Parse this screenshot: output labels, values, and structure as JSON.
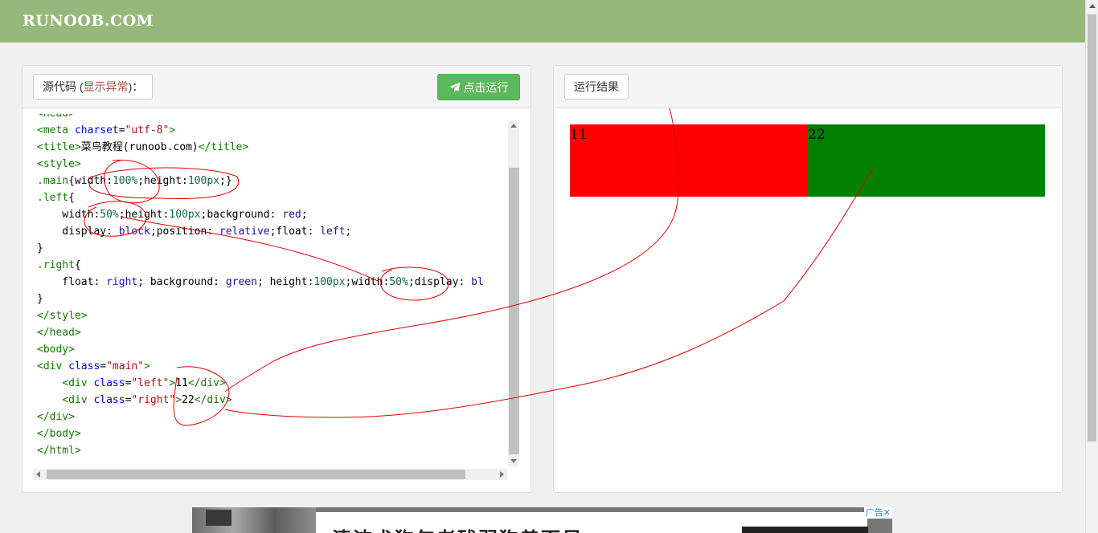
{
  "site": {
    "logo": "RUNOOB.COM"
  },
  "left_panel": {
    "source_label_prefix": "源代码 (",
    "source_label_error": "显示异常",
    "source_label_suffix": ")：",
    "run_button": "点击运行",
    "code_lines": [
      [
        {
          "c": "t",
          "v": "<head>"
        }
      ],
      [
        {
          "c": "t",
          "v": "<meta "
        },
        {
          "c": "a",
          "v": "charset"
        },
        {
          "c": "q",
          "v": "="
        },
        {
          "c": "s",
          "v": "\"utf-8\""
        },
        {
          "c": "t",
          "v": ">"
        }
      ],
      [
        {
          "c": "t",
          "v": "<title>"
        },
        {
          "c": "q",
          "v": "菜鸟教程(runoob.com)"
        },
        {
          "c": "t",
          "v": "</title>"
        }
      ],
      [
        {
          "c": "t",
          "v": "<style>"
        }
      ],
      [
        {
          "c": "t",
          "v": ".main"
        },
        {
          "c": "q",
          "v": "{width:"
        },
        {
          "c": "n",
          "v": "100%"
        },
        {
          "c": "q",
          "v": ";height:"
        },
        {
          "c": "n",
          "v": "100px"
        },
        {
          "c": "q",
          "v": ";}"
        }
      ],
      [
        {
          "c": "t",
          "v": ".left"
        },
        {
          "c": "q",
          "v": "{"
        }
      ],
      [
        {
          "c": "q",
          "v": "    width:"
        },
        {
          "c": "n",
          "v": "50%"
        },
        {
          "c": "q",
          "v": ";height:"
        },
        {
          "c": "n",
          "v": "100px"
        },
        {
          "c": "q",
          "v": ";background: "
        },
        {
          "c": "k",
          "v": "red"
        },
        {
          "c": "q",
          "v": ";"
        }
      ],
      [
        {
          "c": "q",
          "v": "    display: "
        },
        {
          "c": "k",
          "v": "block"
        },
        {
          "c": "q",
          "v": ";position: "
        },
        {
          "c": "k",
          "v": "relative"
        },
        {
          "c": "q",
          "v": ";float: "
        },
        {
          "c": "k",
          "v": "left"
        },
        {
          "c": "q",
          "v": ";"
        }
      ],
      [
        {
          "c": "q",
          "v": "}"
        }
      ],
      [
        {
          "c": "t",
          "v": ".right"
        },
        {
          "c": "q",
          "v": "{"
        }
      ],
      [
        {
          "c": "q",
          "v": "    float: "
        },
        {
          "c": "k",
          "v": "right"
        },
        {
          "c": "q",
          "v": "; background: "
        },
        {
          "c": "k",
          "v": "green"
        },
        {
          "c": "q",
          "v": "; height:"
        },
        {
          "c": "n",
          "v": "100px"
        },
        {
          "c": "q",
          "v": ";width:"
        },
        {
          "c": "n",
          "v": "50%"
        },
        {
          "c": "q",
          "v": ";display: "
        },
        {
          "c": "k",
          "v": "bl"
        }
      ],
      [
        {
          "c": "q",
          "v": "}"
        }
      ],
      [
        {
          "c": "t",
          "v": "</style>"
        }
      ],
      [
        {
          "c": "t",
          "v": "</head>"
        }
      ],
      [
        {
          "c": "t",
          "v": "<body>"
        }
      ],
      [
        {
          "c": "t",
          "v": "<div "
        },
        {
          "c": "a",
          "v": "class"
        },
        {
          "c": "q",
          "v": "="
        },
        {
          "c": "s",
          "v": "\"main\""
        },
        {
          "c": "t",
          "v": ">"
        }
      ],
      [
        {
          "c": "q",
          "v": "    "
        },
        {
          "c": "t",
          "v": "<div "
        },
        {
          "c": "a",
          "v": "class"
        },
        {
          "c": "q",
          "v": "="
        },
        {
          "c": "s",
          "v": "\"left\""
        },
        {
          "c": "t",
          "v": ">"
        },
        {
          "c": "q",
          "v": "11"
        },
        {
          "c": "t",
          "v": "</div>"
        }
      ],
      [
        {
          "c": "q",
          "v": "    "
        },
        {
          "c": "t",
          "v": "<div "
        },
        {
          "c": "a",
          "v": "class"
        },
        {
          "c": "q",
          "v": "="
        },
        {
          "c": "s",
          "v": "\"right\""
        },
        {
          "c": "t",
          "v": ">"
        },
        {
          "c": "q",
          "v": "22"
        },
        {
          "c": "t",
          "v": "</div>"
        }
      ],
      [
        {
          "c": "t",
          "v": "</div>"
        }
      ],
      [
        {
          "c": "t",
          "v": "</body>"
        }
      ],
      [
        {
          "c": "t",
          "v": "</html>"
        }
      ]
    ]
  },
  "right_panel": {
    "result_label": "运行结果",
    "left_box_text": "11",
    "right_box_text": "22",
    "left_box_color": "#ff0000",
    "right_box_color": "#008000"
  },
  "ad": {
    "headline": "清洁犬狗年老残弱狗善而尽",
    "tag": "广告"
  },
  "colors": {
    "header": "#96b97b",
    "run_button": "#5cb85c",
    "annotation_ink": "#e00000"
  },
  "icons": {
    "run": "paper-plane-icon"
  }
}
